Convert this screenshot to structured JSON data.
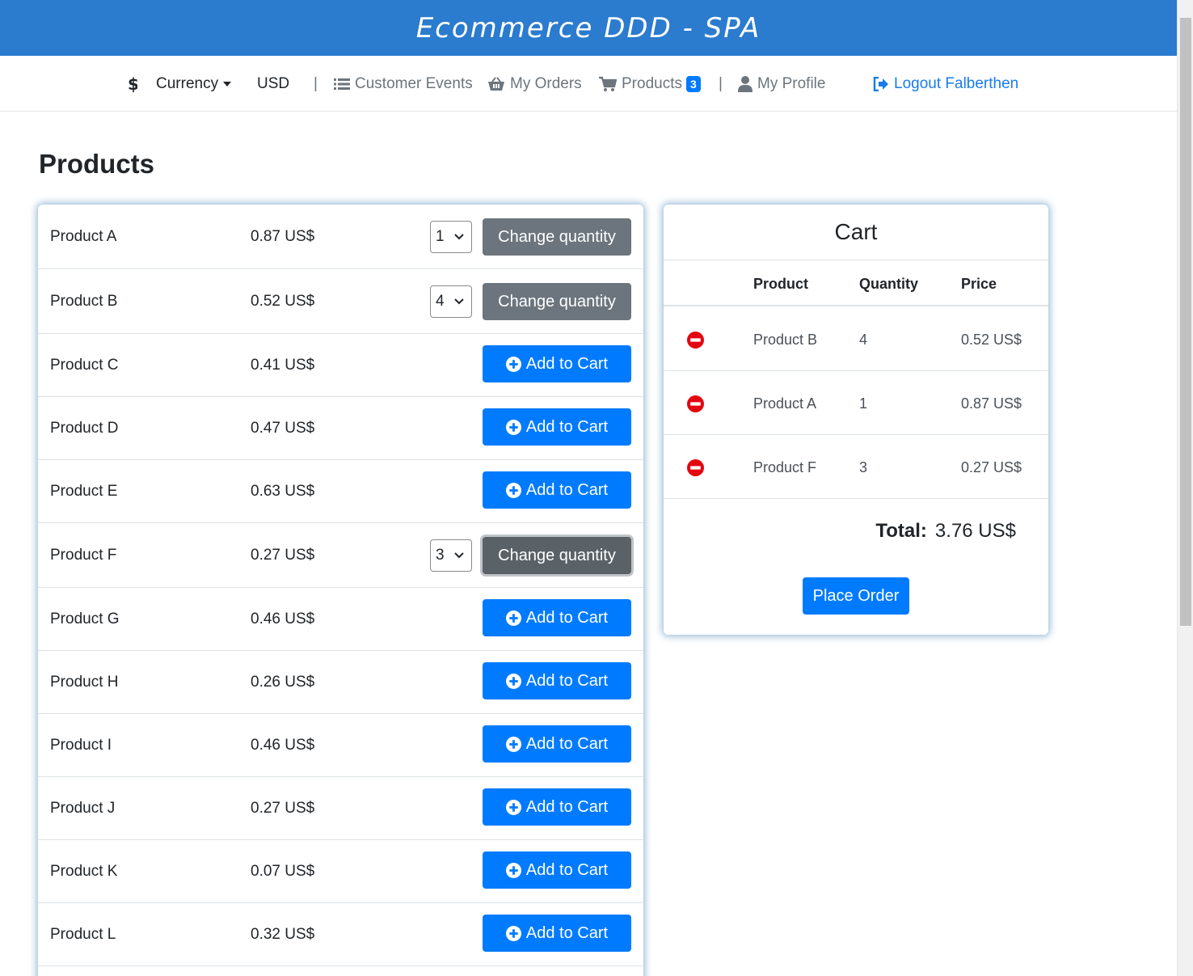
{
  "header": {
    "title": "Ecommerce DDD - SPA"
  },
  "nav": {
    "currency_label": "Currency",
    "currency_value": "USD",
    "separator": "|",
    "customer_events": "Customer Events",
    "my_orders": "My Orders",
    "products": "Products",
    "products_badge": "3",
    "my_profile": "My Profile",
    "logout": "Logout Falberthen"
  },
  "page": {
    "title": "Products"
  },
  "products": [
    {
      "name": "Product A",
      "price": "0.87 US$",
      "in_cart": true,
      "qty": "1",
      "action": "Change quantity"
    },
    {
      "name": "Product B",
      "price": "0.52 US$",
      "in_cart": true,
      "qty": "4",
      "action": "Change quantity"
    },
    {
      "name": "Product C",
      "price": "0.41 US$",
      "in_cart": false,
      "action": "Add to Cart"
    },
    {
      "name": "Product D",
      "price": "0.47 US$",
      "in_cart": false,
      "action": "Add to Cart"
    },
    {
      "name": "Product E",
      "price": "0.63 US$",
      "in_cart": false,
      "action": "Add to Cart"
    },
    {
      "name": "Product F",
      "price": "0.27 US$",
      "in_cart": true,
      "qty": "3",
      "action": "Change quantity",
      "active": true
    },
    {
      "name": "Product G",
      "price": "0.46 US$",
      "in_cart": false,
      "action": "Add to Cart"
    },
    {
      "name": "Product H",
      "price": "0.26 US$",
      "in_cart": false,
      "action": "Add to Cart"
    },
    {
      "name": "Product I",
      "price": "0.46 US$",
      "in_cart": false,
      "action": "Add to Cart"
    },
    {
      "name": "Product J",
      "price": "0.27 US$",
      "in_cart": false,
      "action": "Add to Cart"
    },
    {
      "name": "Product K",
      "price": "0.07 US$",
      "in_cart": false,
      "action": "Add to Cart"
    },
    {
      "name": "Product L",
      "price": "0.32 US$",
      "in_cart": false,
      "action": "Add to Cart"
    }
  ],
  "cart": {
    "title": "Cart",
    "columns": [
      "Product",
      "Quantity",
      "Price"
    ],
    "items": [
      {
        "product": "Product B",
        "quantity": "4",
        "price": "0.52 US$"
      },
      {
        "product": "Product A",
        "quantity": "1",
        "price": "0.87 US$"
      },
      {
        "product": "Product F",
        "quantity": "3",
        "price": "0.27 US$"
      }
    ],
    "total_label": "Total:",
    "total_value": "3.76 US$",
    "place_order": "Place Order"
  },
  "colors": {
    "header_bg": "#2b7bce",
    "primary": "#007bff",
    "secondary": "#6c757d",
    "danger": "#e3060f",
    "link": "#1a7be8"
  },
  "icons": [
    "dollar-icon",
    "list-icon",
    "basket-icon",
    "cart-icon",
    "user-icon",
    "sign-out-icon",
    "plus-circle-icon",
    "minus-circle-icon",
    "chevron-down-icon"
  ]
}
